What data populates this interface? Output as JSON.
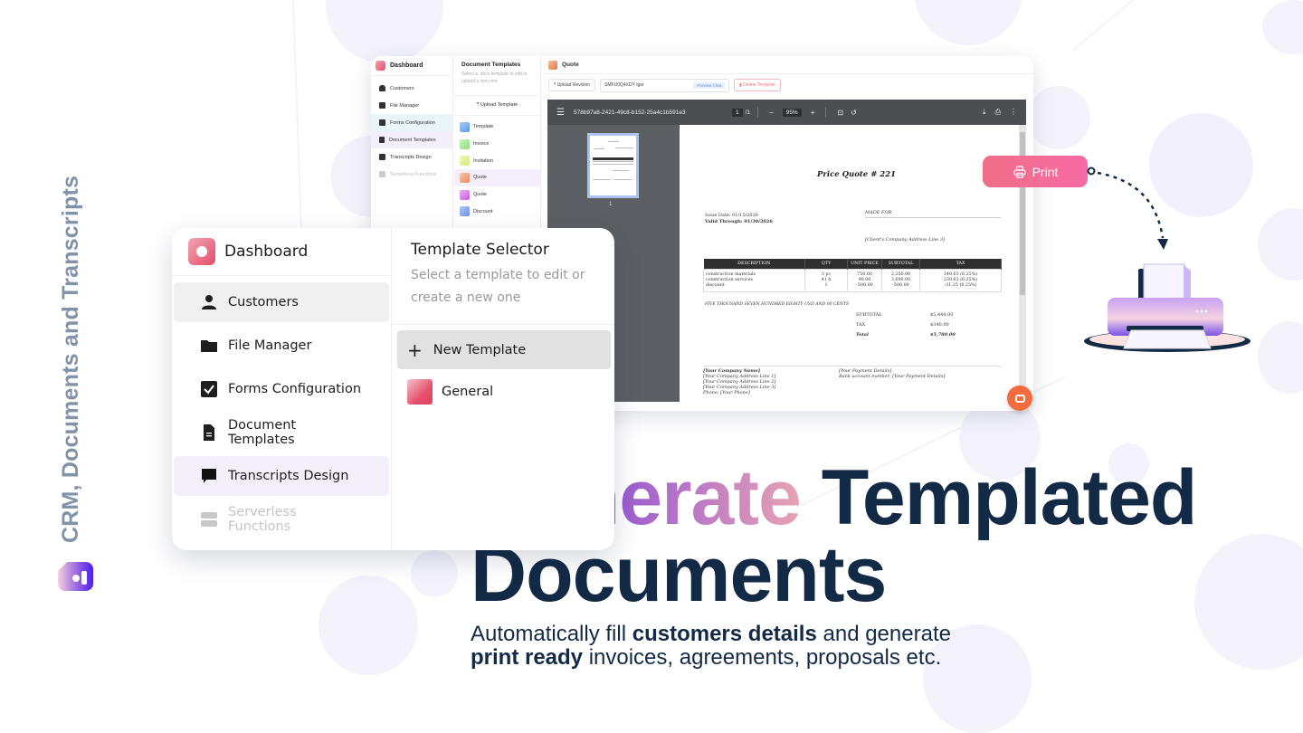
{
  "side_tagline": "CRM, Documents and Transcripts",
  "back_window": {
    "app_title": "Dashboard",
    "sidebar": [
      {
        "label": "Customers",
        "icon": "user-icon",
        "state": "normal"
      },
      {
        "label": "File Manager",
        "icon": "folder-icon",
        "state": "normal"
      },
      {
        "label": "Forms Configuration",
        "icon": "checkbox-icon",
        "state": "hover"
      },
      {
        "label": "Document Templates",
        "icon": "document-icon",
        "state": "selected"
      },
      {
        "label": "Transcripts Design",
        "icon": "chat-icon",
        "state": "normal"
      },
      {
        "label": "Serverless Functions",
        "icon": "server-icon",
        "state": "disabled"
      }
    ],
    "templates_panel": {
      "title": "Document Templates",
      "subtitle": "Select a .docx template to edit or upload a new one",
      "upload_label": "Upload Template",
      "items": [
        {
          "label": "Template",
          "color": "#5b9be8"
        },
        {
          "label": "Invoice",
          "color": "#8fdc7a"
        },
        {
          "label": "Invitation",
          "color": "#d8ea7b"
        },
        {
          "label": "Quote",
          "color": "#e88a5c"
        },
        {
          "label": "Quote",
          "color": "#c35fd8"
        },
        {
          "label": "Discount",
          "color": "#6b8fe8"
        }
      ],
      "selected_index": 3
    },
    "main": {
      "title": "Quote",
      "upload_revision_label": "Upload Revision",
      "chat_field_value": "SMFU0Q4XDY Igor",
      "preview_chat_label": "Preview Chat",
      "delete_label": "Delete Template"
    },
    "pdf_viewer": {
      "filename": "578b97a8-2421-49c8-b152-25a4c1b591e3",
      "current_page": "1",
      "total_pages": "1",
      "zoom": "95%",
      "thumb_page_label": "1"
    },
    "quote_doc": {
      "title": "Price Quote #  221",
      "issue_date": "Issue Date: 01/15/2026",
      "valid_through": "Valid Through: 01/30/2026",
      "made_for": "MADE FOR",
      "client_address": "[Client's Company Address Line 3]",
      "table": {
        "headers": [
          "DESCRIPTION",
          "QTY",
          "UNIT PRICE",
          "SUBTOTAL",
          "TAX"
        ],
        "rows": [
          [
            "construction materials",
            "3 pc",
            "750.00",
            "2,250.00",
            "140.63 (6.25%)"
          ],
          [
            "construction services",
            "41 h",
            "90.00",
            "3,690.00",
            "230.63 (6.25%)"
          ],
          [
            "discount",
            "1",
            "-500.00",
            "-500.00",
            "-31.25 (6.25%)"
          ]
        ]
      },
      "amount_in_words": "FIVE THOUSAND  SEVEN HUNDRED EIGHTY USD AND 00 CENTS",
      "summary": [
        {
          "label": "SUBTOTAL",
          "value": "$5,440.00"
        },
        {
          "label": "TAX",
          "value": "$340.00"
        },
        {
          "label": "Total",
          "value": "$5,780.00"
        }
      ],
      "footer_left": [
        "[Your Company Name]",
        "[Your Company Address Line 1]",
        "[Your Company Address Line 2]",
        "[Your Company Address Line 3]",
        "Phone: [Your Phone]"
      ],
      "footer_right": [
        "[Your Payment Details]",
        "Bank account number: [Your Payment Details]"
      ]
    }
  },
  "print_button_label": "Print",
  "front_card": {
    "app_title": "Dashboard",
    "sidebar": [
      {
        "label": "Customers",
        "icon": "user-icon",
        "state": "selected"
      },
      {
        "label": "File Manager",
        "icon": "folder-icon",
        "state": "normal"
      },
      {
        "label": "Forms Configuration",
        "icon": "checkbox-icon",
        "state": "normal"
      },
      {
        "label": "Document Templates",
        "icon": "document-icon",
        "state": "normal"
      },
      {
        "label": "Transcripts Design",
        "icon": "chat-icon",
        "state": "hover"
      },
      {
        "label": "Serverless Functions",
        "icon": "server-icon",
        "state": "disabled"
      }
    ],
    "selector": {
      "title": "Template Selector",
      "subtitle": "Select a template to edit or create a new one",
      "new_template_label": "New Template",
      "templates": [
        {
          "label": "General",
          "color": "#e5536d"
        }
      ]
    }
  },
  "headline": {
    "gradient_word": "Generate",
    "rest_line1": "Templated",
    "line2": "Documents",
    "gradient_colors": [
      "#4a1cf0",
      "#9b5cd0",
      "#e8a3b2"
    ],
    "text_color": "#132a46"
  },
  "subtext": {
    "part1": "Automatically fill ",
    "bold1": "customers details",
    "part2": " and generate",
    "bold2": "print ready",
    "part3": " invoices, agreements, proposals etc."
  },
  "colors": {
    "print_pill": "#f06f86",
    "chat_bubble": "#f36c3d",
    "tagline": "#8193a8"
  }
}
